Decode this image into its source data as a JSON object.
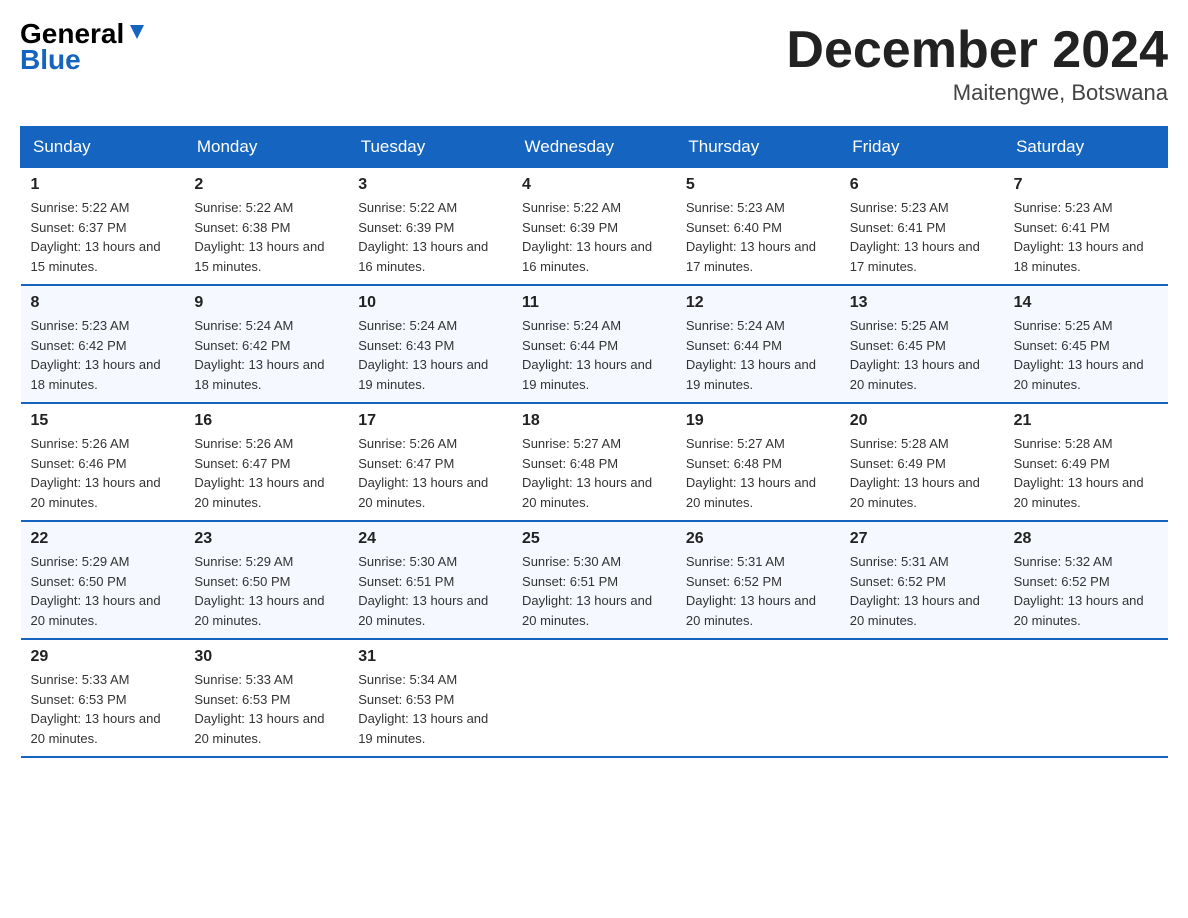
{
  "logo": {
    "text_general": "General",
    "text_blue": "Blue"
  },
  "title": {
    "month": "December 2024",
    "location": "Maitengwe, Botswana"
  },
  "header_days": [
    "Sunday",
    "Monday",
    "Tuesday",
    "Wednesday",
    "Thursday",
    "Friday",
    "Saturday"
  ],
  "weeks": [
    [
      {
        "day": "1",
        "sunrise": "5:22 AM",
        "sunset": "6:37 PM",
        "daylight": "13 hours and 15 minutes."
      },
      {
        "day": "2",
        "sunrise": "5:22 AM",
        "sunset": "6:38 PM",
        "daylight": "13 hours and 15 minutes."
      },
      {
        "day": "3",
        "sunrise": "5:22 AM",
        "sunset": "6:39 PM",
        "daylight": "13 hours and 16 minutes."
      },
      {
        "day": "4",
        "sunrise": "5:22 AM",
        "sunset": "6:39 PM",
        "daylight": "13 hours and 16 minutes."
      },
      {
        "day": "5",
        "sunrise": "5:23 AM",
        "sunset": "6:40 PM",
        "daylight": "13 hours and 17 minutes."
      },
      {
        "day": "6",
        "sunrise": "5:23 AM",
        "sunset": "6:41 PM",
        "daylight": "13 hours and 17 minutes."
      },
      {
        "day": "7",
        "sunrise": "5:23 AM",
        "sunset": "6:41 PM",
        "daylight": "13 hours and 18 minutes."
      }
    ],
    [
      {
        "day": "8",
        "sunrise": "5:23 AM",
        "sunset": "6:42 PM",
        "daylight": "13 hours and 18 minutes."
      },
      {
        "day": "9",
        "sunrise": "5:24 AM",
        "sunset": "6:42 PM",
        "daylight": "13 hours and 18 minutes."
      },
      {
        "day": "10",
        "sunrise": "5:24 AM",
        "sunset": "6:43 PM",
        "daylight": "13 hours and 19 minutes."
      },
      {
        "day": "11",
        "sunrise": "5:24 AM",
        "sunset": "6:44 PM",
        "daylight": "13 hours and 19 minutes."
      },
      {
        "day": "12",
        "sunrise": "5:24 AM",
        "sunset": "6:44 PM",
        "daylight": "13 hours and 19 minutes."
      },
      {
        "day": "13",
        "sunrise": "5:25 AM",
        "sunset": "6:45 PM",
        "daylight": "13 hours and 20 minutes."
      },
      {
        "day": "14",
        "sunrise": "5:25 AM",
        "sunset": "6:45 PM",
        "daylight": "13 hours and 20 minutes."
      }
    ],
    [
      {
        "day": "15",
        "sunrise": "5:26 AM",
        "sunset": "6:46 PM",
        "daylight": "13 hours and 20 minutes."
      },
      {
        "day": "16",
        "sunrise": "5:26 AM",
        "sunset": "6:47 PM",
        "daylight": "13 hours and 20 minutes."
      },
      {
        "day": "17",
        "sunrise": "5:26 AM",
        "sunset": "6:47 PM",
        "daylight": "13 hours and 20 minutes."
      },
      {
        "day": "18",
        "sunrise": "5:27 AM",
        "sunset": "6:48 PM",
        "daylight": "13 hours and 20 minutes."
      },
      {
        "day": "19",
        "sunrise": "5:27 AM",
        "sunset": "6:48 PM",
        "daylight": "13 hours and 20 minutes."
      },
      {
        "day": "20",
        "sunrise": "5:28 AM",
        "sunset": "6:49 PM",
        "daylight": "13 hours and 20 minutes."
      },
      {
        "day": "21",
        "sunrise": "5:28 AM",
        "sunset": "6:49 PM",
        "daylight": "13 hours and 20 minutes."
      }
    ],
    [
      {
        "day": "22",
        "sunrise": "5:29 AM",
        "sunset": "6:50 PM",
        "daylight": "13 hours and 20 minutes."
      },
      {
        "day": "23",
        "sunrise": "5:29 AM",
        "sunset": "6:50 PM",
        "daylight": "13 hours and 20 minutes."
      },
      {
        "day": "24",
        "sunrise": "5:30 AM",
        "sunset": "6:51 PM",
        "daylight": "13 hours and 20 minutes."
      },
      {
        "day": "25",
        "sunrise": "5:30 AM",
        "sunset": "6:51 PM",
        "daylight": "13 hours and 20 minutes."
      },
      {
        "day": "26",
        "sunrise": "5:31 AM",
        "sunset": "6:52 PM",
        "daylight": "13 hours and 20 minutes."
      },
      {
        "day": "27",
        "sunrise": "5:31 AM",
        "sunset": "6:52 PM",
        "daylight": "13 hours and 20 minutes."
      },
      {
        "day": "28",
        "sunrise": "5:32 AM",
        "sunset": "6:52 PM",
        "daylight": "13 hours and 20 minutes."
      }
    ],
    [
      {
        "day": "29",
        "sunrise": "5:33 AM",
        "sunset": "6:53 PM",
        "daylight": "13 hours and 20 minutes."
      },
      {
        "day": "30",
        "sunrise": "5:33 AM",
        "sunset": "6:53 PM",
        "daylight": "13 hours and 20 minutes."
      },
      {
        "day": "31",
        "sunrise": "5:34 AM",
        "sunset": "6:53 PM",
        "daylight": "13 hours and 19 minutes."
      },
      null,
      null,
      null,
      null
    ]
  ]
}
